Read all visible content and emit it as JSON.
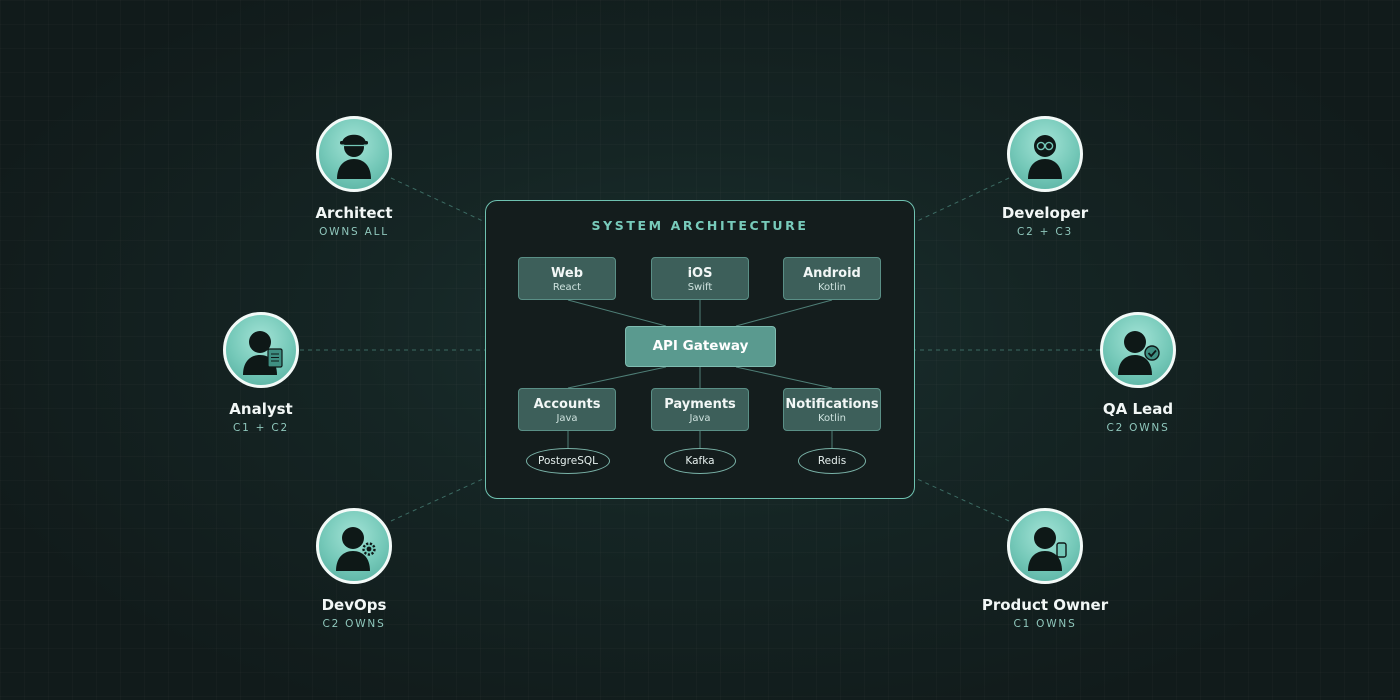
{
  "panel": {
    "title": "SYSTEM ARCHITECTURE",
    "clients": [
      {
        "title": "Web",
        "tech": "React"
      },
      {
        "title": "iOS",
        "tech": "Swift"
      },
      {
        "title": "Android",
        "tech": "Kotlin"
      }
    ],
    "gateway": "API Gateway",
    "services": [
      {
        "title": "Accounts",
        "tech": "Java"
      },
      {
        "title": "Payments",
        "tech": "Java"
      },
      {
        "title": "Notifications",
        "tech": "Kotlin"
      }
    ],
    "stores": [
      "PostgreSQL",
      "Kafka",
      "Redis"
    ]
  },
  "personas": {
    "architect": {
      "name": "Architect",
      "role": "OWNS ALL",
      "icon": "person-with-hat-icon"
    },
    "analyst": {
      "name": "Analyst",
      "role": "C1 + C2",
      "icon": "person-with-document-icon"
    },
    "devops": {
      "name": "DevOps",
      "role": "C2 OWNS",
      "icon": "person-with-gear-icon"
    },
    "developer": {
      "name": "Developer",
      "role": "C2 + C3",
      "icon": "person-with-glasses-icon"
    },
    "qa_lead": {
      "name": "QA Lead",
      "role": "C2 OWNS",
      "icon": "person-with-checkmark-icon"
    },
    "product_owner": {
      "name": "Product Owner",
      "role": "C1 OWNS",
      "icon": "person-with-phone-icon"
    }
  },
  "colors": {
    "accent": "#78cbbb",
    "avatar": "#74c8b8",
    "node": "#3d5f5a",
    "gateway": "#5a9a8f",
    "background": "#131f1f"
  }
}
